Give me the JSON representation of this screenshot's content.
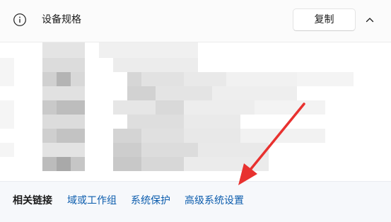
{
  "header": {
    "title": "设备规格",
    "copy_label": "复制",
    "icons": {
      "info": "info-icon",
      "collapse": "chevron-up-icon"
    }
  },
  "specs": {
    "content": "pixelated",
    "colors": {
      "background": "#ffffff",
      "pixel_light": "#e6e6e6",
      "pixel_mid": "#cfcfcf",
      "pixel_dark": "#a8a8a8"
    }
  },
  "related": {
    "label": "相关链接",
    "links": [
      {
        "label": "域或工作组"
      },
      {
        "label": "系统保护"
      },
      {
        "label": "高级系统设置"
      }
    ]
  },
  "annotation": {
    "shape": "arrow",
    "color": "#e8312f",
    "points_to": "高级系统设置"
  },
  "colors": {
    "link": "#0b5cad",
    "text": "#1a1a1a",
    "header_bg": "#fbfbfb",
    "footer_bg": "#f6f8fb"
  }
}
